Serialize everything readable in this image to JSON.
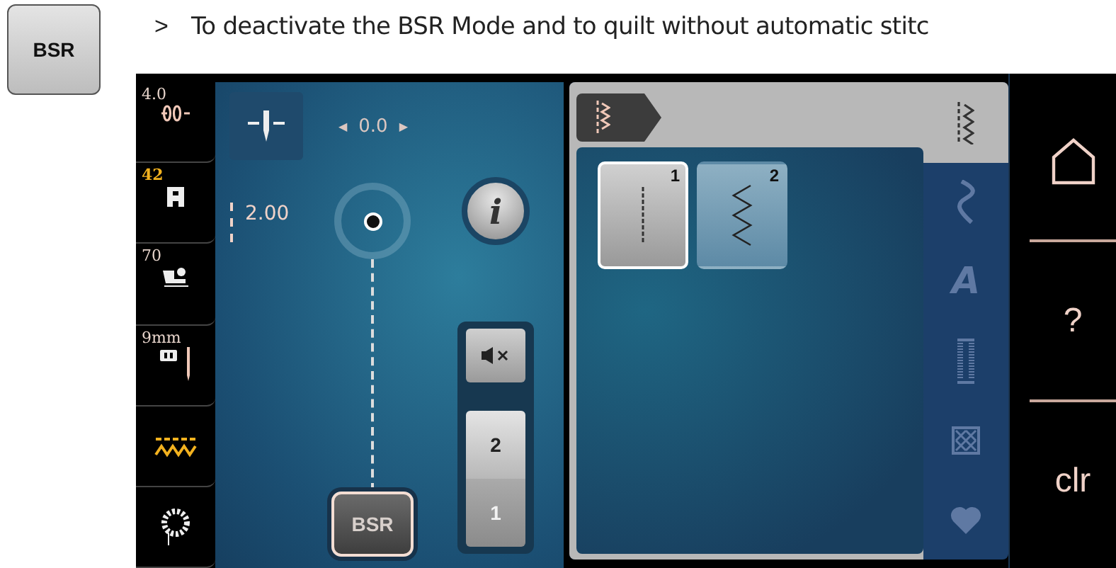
{
  "instruction": {
    "key_label": "BSR",
    "marker": ">",
    "text": "To deactivate the BSR Mode and to quilt without automatic stitc"
  },
  "status_column": [
    {
      "kind": "width",
      "value": "4.0",
      "highlight": false
    },
    {
      "kind": "length",
      "value": "42",
      "highlight": true
    },
    {
      "kind": "foot",
      "value": "70",
      "highlight": false
    },
    {
      "kind": "plate",
      "value": "9mm",
      "highlight": false
    },
    {
      "kind": "stitch",
      "highlight": true
    },
    {
      "kind": "bobbin"
    }
  ],
  "needle_position": {
    "value": "0.0",
    "left_arrow": "◀",
    "right_arrow": "▶"
  },
  "stitch_length": "2.00",
  "info_button": "i",
  "bsr_button": {
    "label": "BSR",
    "selected": true
  },
  "counter": [
    {
      "label": "2",
      "selected": false
    },
    {
      "label": "1",
      "selected": true
    }
  ],
  "stitches": [
    {
      "number": "1",
      "kind": "straight",
      "selected": true
    },
    {
      "number": "2",
      "kind": "zigzag",
      "selected": false
    }
  ],
  "categories": [
    {
      "kind": "practical",
      "selected": true
    },
    {
      "kind": "decorative",
      "selected": false
    },
    {
      "kind": "alphabet",
      "label": "A",
      "selected": false
    },
    {
      "kind": "buttonhole",
      "selected": false
    },
    {
      "kind": "quilt",
      "selected": false
    },
    {
      "kind": "personal",
      "selected": false
    }
  ],
  "right_buttons": [
    {
      "kind": "home"
    },
    {
      "kind": "help",
      "label": "?"
    },
    {
      "kind": "clear",
      "label": "clr"
    }
  ]
}
